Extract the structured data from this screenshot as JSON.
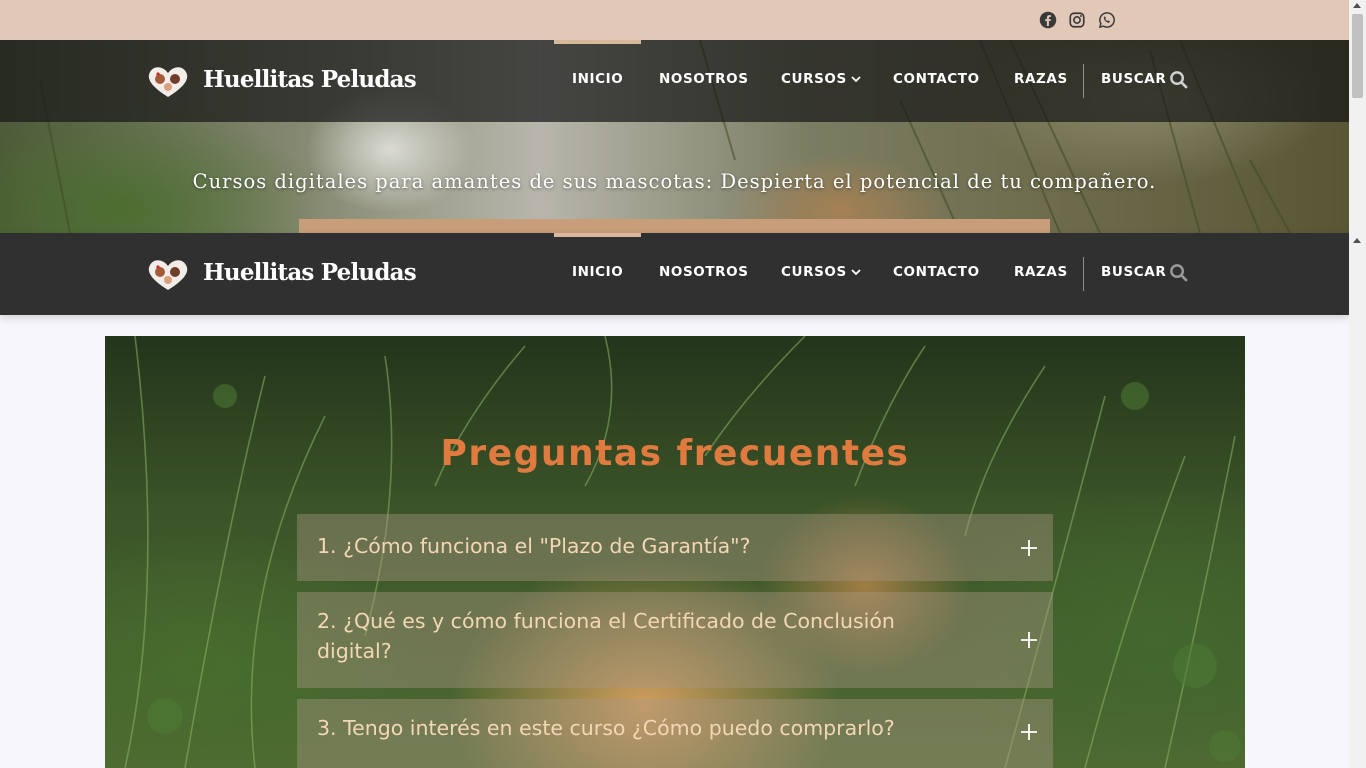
{
  "colors": {
    "topbar_bg": "#e2c8b7",
    "nav_dark": "#303030",
    "accent_tan": "#d7b89b",
    "faq_title": "#e07a3f",
    "faq_question": "#f3d7b5",
    "social_icon": "#3a3a3a"
  },
  "social": {
    "items": [
      {
        "name": "facebook-icon"
      },
      {
        "name": "instagram-icon"
      },
      {
        "name": "whatsapp-icon"
      }
    ]
  },
  "header": {
    "brand": "Huellitas Peludas",
    "tagline": "Cursos digitales para amantes de sus mascotas: Despierta el potencial de tu compañero."
  },
  "nav": {
    "items": [
      {
        "label": "INICIO",
        "active": true
      },
      {
        "label": "NOSOTROS"
      },
      {
        "label": "CURSOS",
        "has_dropdown": true
      },
      {
        "label": "CONTACTO"
      },
      {
        "label": "RAZAS"
      }
    ],
    "search_label": "BUSCAR"
  },
  "faq": {
    "title": "Preguntas frecuentes",
    "items": [
      {
        "question": "1. ¿Cómo funciona el \"Plazo de Garantía\"?"
      },
      {
        "question": "2. ¿Qué es y cómo funciona el Certificado de Conclusión digital?"
      },
      {
        "question": "3. Tengo interés en este curso ¿Cómo puedo comprarlo?"
      }
    ]
  }
}
